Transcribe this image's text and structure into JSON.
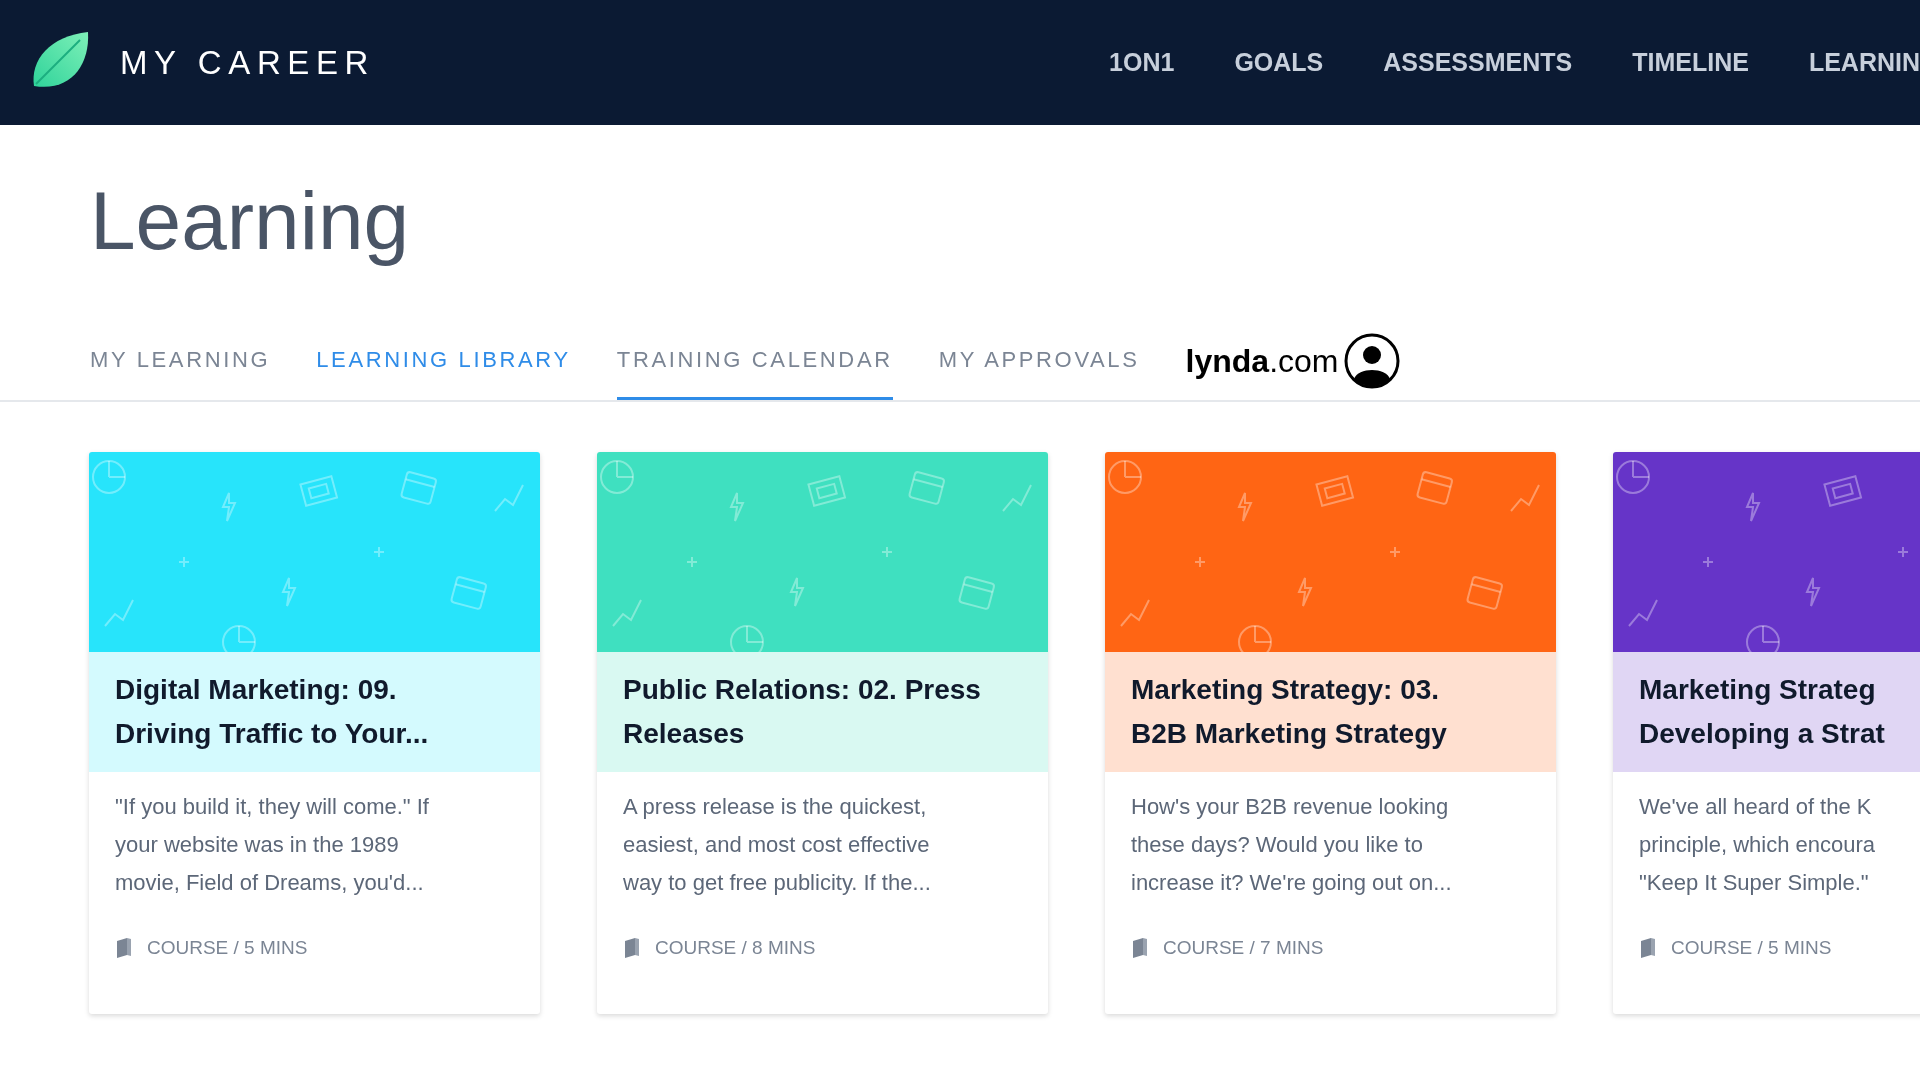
{
  "header": {
    "brand": "MY CAREER",
    "nav": [
      {
        "label": "1ON1"
      },
      {
        "label": "GOALS"
      },
      {
        "label": "ASSESSMENTS"
      },
      {
        "label": "TIMELINE"
      },
      {
        "label": "LEARNIN"
      }
    ]
  },
  "page": {
    "title": "Learning"
  },
  "tabs": [
    {
      "label": "MY LEARNING",
      "selected": false,
      "underlined": false
    },
    {
      "label": "LEARNING LIBRARY",
      "selected": true,
      "underlined": false
    },
    {
      "label": "TRAINING CALENDAR",
      "selected": false,
      "underlined": true
    },
    {
      "label": "MY APPROVALS",
      "selected": false,
      "underlined": false
    }
  ],
  "partner_logo": {
    "text_bold": "lynda",
    "text_light": ".com"
  },
  "cards": [
    {
      "color": "#27e4fb",
      "title": [
        "Digital Marketing: 09.",
        "Driving Traffic to Your..."
      ],
      "description": [
        "\"If you build it, they will come.\" If",
        "your website was in the 1989",
        "movie, Field of Dreams, you'd..."
      ],
      "meta": "COURSE / 5 MINS"
    },
    {
      "color": "#3fe0c0",
      "title": [
        "Public Relations: 02. Press",
        "Releases"
      ],
      "description": [
        "A press release is the quickest,",
        "easiest, and most cost effective",
        "way to get free publicity. If the..."
      ],
      "meta": "COURSE / 8 MINS"
    },
    {
      "color": "#ff6514",
      "title": [
        "Marketing Strategy: 03.",
        "B2B Marketing Strategy"
      ],
      "description": [
        "How's your B2B revenue looking",
        "these days? Would you like to",
        "increase it? We're going out on..."
      ],
      "meta": "COURSE / 7 MINS"
    },
    {
      "color": "#6634c8",
      "title": [
        "Marketing Strateg",
        "Developing a Strat"
      ],
      "description": [
        "We've all heard of the K",
        "principle, which encoura",
        "\"Keep It Super Simple.\""
      ],
      "meta": "COURSE / 5 MINS"
    }
  ]
}
